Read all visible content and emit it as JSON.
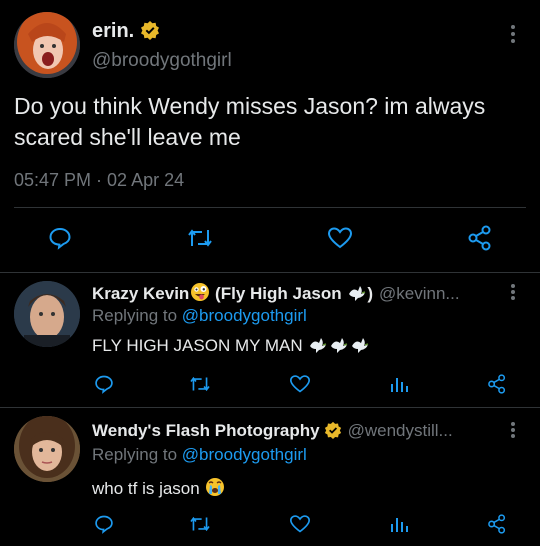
{
  "main_tweet": {
    "display_name": "erin.",
    "handle": "@broodygothgirl",
    "text": "Do you think Wendy misses Jason? im always scared she'll leave me",
    "timestamp": "05:47 PM · 02 Apr 24"
  },
  "replies": [
    {
      "display_name": "Krazy Kevin",
      "display_name_suffix": " (Fly High Jason ",
      "display_name_end": ")",
      "handle": "@kevinn...",
      "replying_prefix": "Replying to",
      "replying_to": "@broodygothgirl",
      "text": "FLY HIGH JASON MY MAN "
    },
    {
      "display_name": "Wendy's Flash Photography",
      "handle": "@wendystill...",
      "replying_prefix": "Replying to",
      "replying_to": "@broodygothgirl",
      "text": "who tf is jason "
    }
  ],
  "colors": {
    "background": "#000000",
    "text": "#e7e9ea",
    "muted": "#71767b",
    "link": "#1d9bf0",
    "verified": "#e8b82a"
  },
  "icons": [
    "verified-badge-icon",
    "more-options-icon",
    "reply-icon",
    "retweet-icon",
    "like-icon",
    "share-icon",
    "views-icon",
    "dove-icon",
    "zany-face-icon",
    "crying-face-icon"
  ]
}
